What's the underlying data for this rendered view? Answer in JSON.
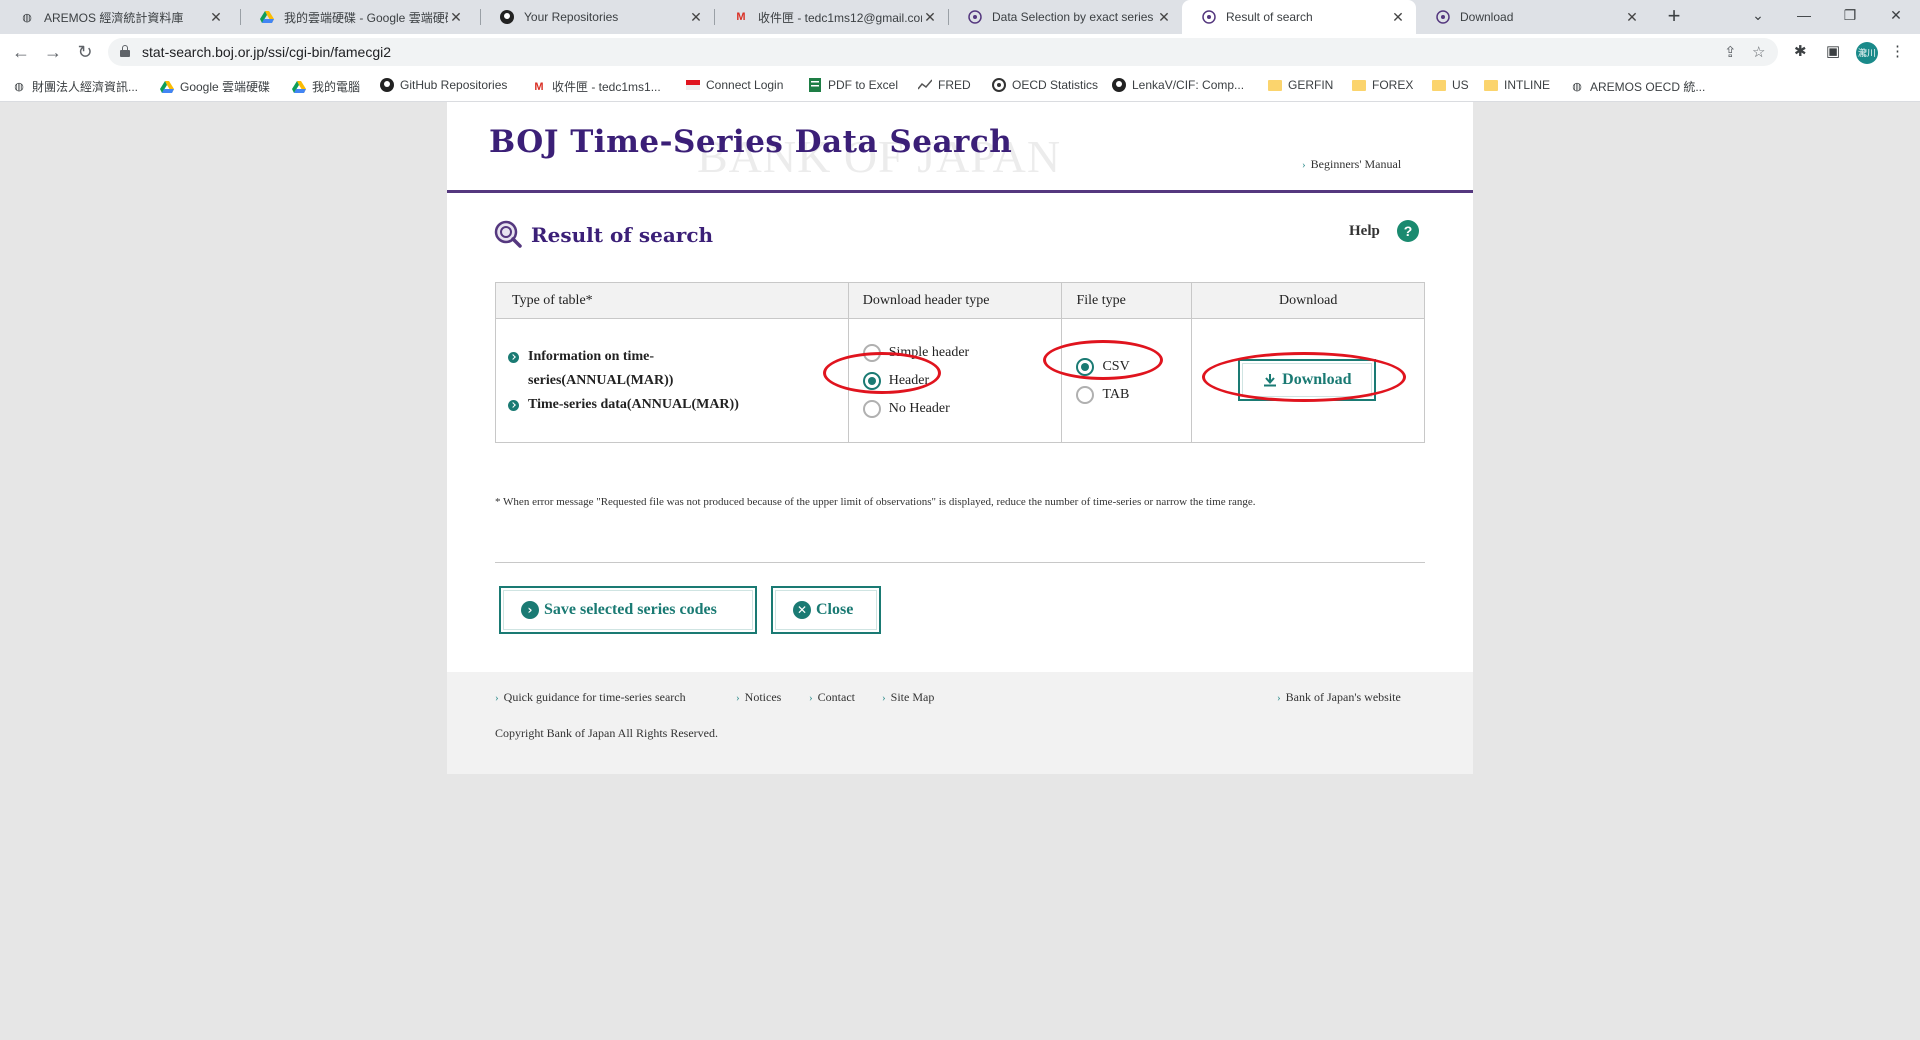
{
  "browser": {
    "tabs": [
      {
        "label": "AREMOS 經濟統計資料庫",
        "icon": "globe-icon"
      },
      {
        "label": "我的雲端硬碟 - Google 雲端硬碟",
        "icon": "google-drive-icon"
      },
      {
        "label": "Your Repositories",
        "icon": "github-icon"
      },
      {
        "label": "收件匣 - tedc1ms12@gmail.com",
        "icon": "gmail-icon"
      },
      {
        "label": "Data Selection by exact series",
        "icon": "boj-icon"
      },
      {
        "label": "Result of search",
        "icon": "boj-icon"
      },
      {
        "label": "Download",
        "icon": "boj-icon"
      }
    ],
    "active_tab": 5,
    "url": "stat-search.boj.or.jp/ssi/cgi-bin/famecgi2",
    "profile_initials": "瀧川",
    "bookmarks": [
      {
        "label": "財團法人經濟資訊...",
        "icon": "globe-icon"
      },
      {
        "label": "Google 雲端硬碟",
        "icon": "google-drive-icon"
      },
      {
        "label": "我的電腦",
        "icon": "google-drive-icon"
      },
      {
        "label": "GitHub Repositories",
        "icon": "github-icon"
      },
      {
        "label": "收件匣 - tedc1ms1...",
        "icon": "gmail-icon"
      },
      {
        "label": "Connect Login",
        "icon": "flag-icon"
      },
      {
        "label": "PDF to Excel",
        "icon": "pdf-icon"
      },
      {
        "label": "FRED",
        "icon": "chart-icon"
      },
      {
        "label": "OECD Statistics",
        "icon": "oecd-icon"
      },
      {
        "label": "LenkaV/CIF: Comp...",
        "icon": "github-icon"
      },
      {
        "label": "GERFIN",
        "icon": "folder-icon"
      },
      {
        "label": "FOREX",
        "icon": "folder-icon"
      },
      {
        "label": "US",
        "icon": "folder-icon"
      },
      {
        "label": "INTLINE",
        "icon": "folder-icon"
      },
      {
        "label": "AREMOS OECD 統...",
        "icon": "globe-icon"
      }
    ]
  },
  "page": {
    "site_title": "BOJ Time-Series Data Search",
    "site_watermark": "BANK OF JAPAN",
    "beginners_manual": "Beginners' Manual",
    "result_title": "Result of search",
    "help_label": "Help",
    "help_icon_glyph": "?",
    "table": {
      "headers": [
        "Type of table*",
        "Download header type",
        "File type",
        "Download"
      ],
      "table_types": [
        "Information on time-series(ANNUAL(MAR))",
        "Time-series data(ANNUAL(MAR))"
      ],
      "header_options": [
        {
          "label": "Simple header",
          "checked": false
        },
        {
          "label": "Header",
          "checked": true
        },
        {
          "label": "No Header",
          "checked": false
        }
      ],
      "file_types": [
        {
          "label": "CSV",
          "checked": true
        },
        {
          "label": "TAB",
          "checked": false
        }
      ],
      "download_label": "Download"
    },
    "note": "* When error message \"Requested file was not produced because of the upper limit of observations\" is displayed, reduce the number of time-series or narrow the time range.",
    "save_button": "Save selected series codes",
    "close_button": "Close",
    "footer": {
      "links": [
        "Quick guidance for time-series search",
        "Notices",
        "Contact",
        "Site Map"
      ],
      "boj_website": "Bank of Japan's website",
      "copyright": "Copyright Bank of Japan All Rights Reserved."
    }
  },
  "colors": {
    "brand_purple": "#3b1f77",
    "accent_teal": "#1a7a73",
    "annotation_red": "#e0141e"
  }
}
